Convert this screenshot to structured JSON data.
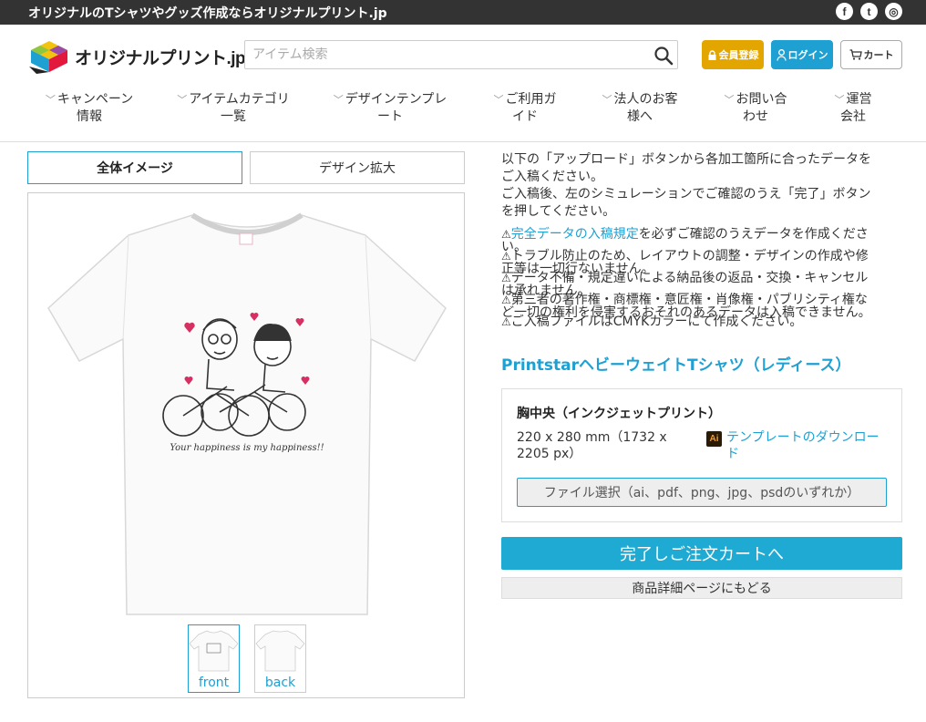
{
  "topbar": {
    "tagline": "オリジナルのTシャツやグッズ作成ならオリジナルプリント.jp",
    "social": [
      {
        "icon": "facebook-icon",
        "glyph": "f"
      },
      {
        "icon": "twitter-icon",
        "glyph": "t"
      },
      {
        "icon": "instagram-icon",
        "glyph": "◎"
      }
    ]
  },
  "header": {
    "logo_text": "オリジナルプリント.jp",
    "search_placeholder": "アイテム検索",
    "register_label": "会員登録",
    "login_label": "ログイン",
    "cart_label": "カート"
  },
  "nav": {
    "items": [
      {
        "line1": "キャンペーン",
        "line2": "情報"
      },
      {
        "line1": "アイテムカテゴリ",
        "line2": "一覧"
      },
      {
        "line1": "デザインテンプレ",
        "line2": "ート"
      },
      {
        "line1": "ご利用ガ",
        "line2": "イド"
      },
      {
        "line1": "法人のお客",
        "line2": "様へ"
      },
      {
        "line1": "お問い合",
        "line2": "わせ"
      },
      {
        "line1": "運営",
        "line2": "会社"
      }
    ]
  },
  "preview": {
    "tab_full": "全体イメージ",
    "tab_zoom": "デザイン拡大",
    "design_caption": "Your happiness is my happiness!!",
    "thumb_front": "front",
    "thumb_back": "back"
  },
  "instructions": {
    "lines": [
      "以下の「アップロード」ボタンから各加工箇所に合ったデータを",
      "ご入稿ください。",
      "ご入稿後、左のシミュレーションでご確認のうえ「完了」ボタン",
      "を押してください。"
    ],
    "notes": [
      {
        "link": "完全データの入稿規定",
        "l1": "を必ずご確認のうえデータを作成くださ",
        "l2": "い。"
      },
      {
        "link": "",
        "l1": "トラブル防止のため、レイアウトの調整・デザインの作成や修",
        "l2": "正等は一切行ないません。"
      },
      {
        "link": "",
        "l1": "データ不備・規定違いによる納品後の返品・交換・キャンセル",
        "l2": "は承れません。"
      },
      {
        "link": "",
        "l1": "第三者の著作権・商標権・意匠権・肖像権・パブリシティ権な",
        "l2": "ど一切の権利を侵害するおそれのあるデータは入稿できません。"
      },
      {
        "link": "",
        "l1": "ご入稿ファイルはCMYKカラーにて作成ください。",
        "l2": ""
      }
    ]
  },
  "product": {
    "title": "PrintstarヘビーウェイトTシャツ（レディース）",
    "area_name": "胸中央（インクジェットプリント）",
    "area_size": "220 x 280 mm（1732 x 2205 px）",
    "ai_badge": "Ai",
    "template_link": "テンプレートのダウンロード",
    "file_button": "ファイル選択（ai、pdf、png、jpg、psdのいずれか）",
    "order_button": "完了しご注文カートへ",
    "back_button": "商品詳細ページにもどる"
  },
  "colors": {
    "accent": "#1ea0d3",
    "register": "#e3a600",
    "topbar": "#333333"
  }
}
